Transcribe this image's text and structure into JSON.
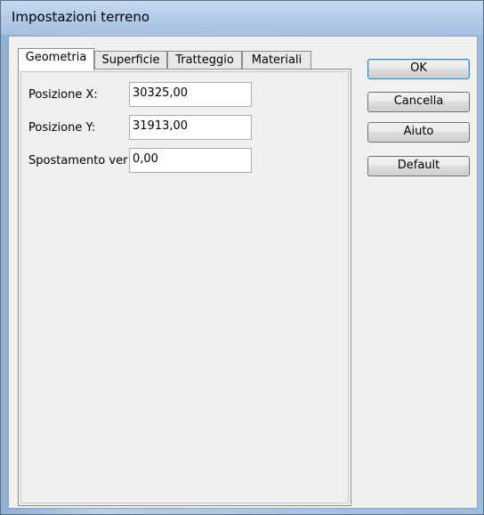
{
  "window": {
    "title": "Impostazioni terreno"
  },
  "tabs": [
    {
      "label": "Geometria",
      "active": true
    },
    {
      "label": "Superficie",
      "active": false
    },
    {
      "label": "Tratteggio",
      "active": false
    },
    {
      "label": "Materiali",
      "active": false
    }
  ],
  "geometry": {
    "pos_x": {
      "label": "Posizione X:",
      "value": "30325,00"
    },
    "pos_y": {
      "label": "Posizione Y:",
      "value": "31913,00"
    },
    "shift": {
      "label": "Spostamento ver",
      "value": "0,00"
    }
  },
  "buttons": {
    "ok": "OK",
    "cancel": "Cancella",
    "help": "Aiuto",
    "default": "Default"
  }
}
